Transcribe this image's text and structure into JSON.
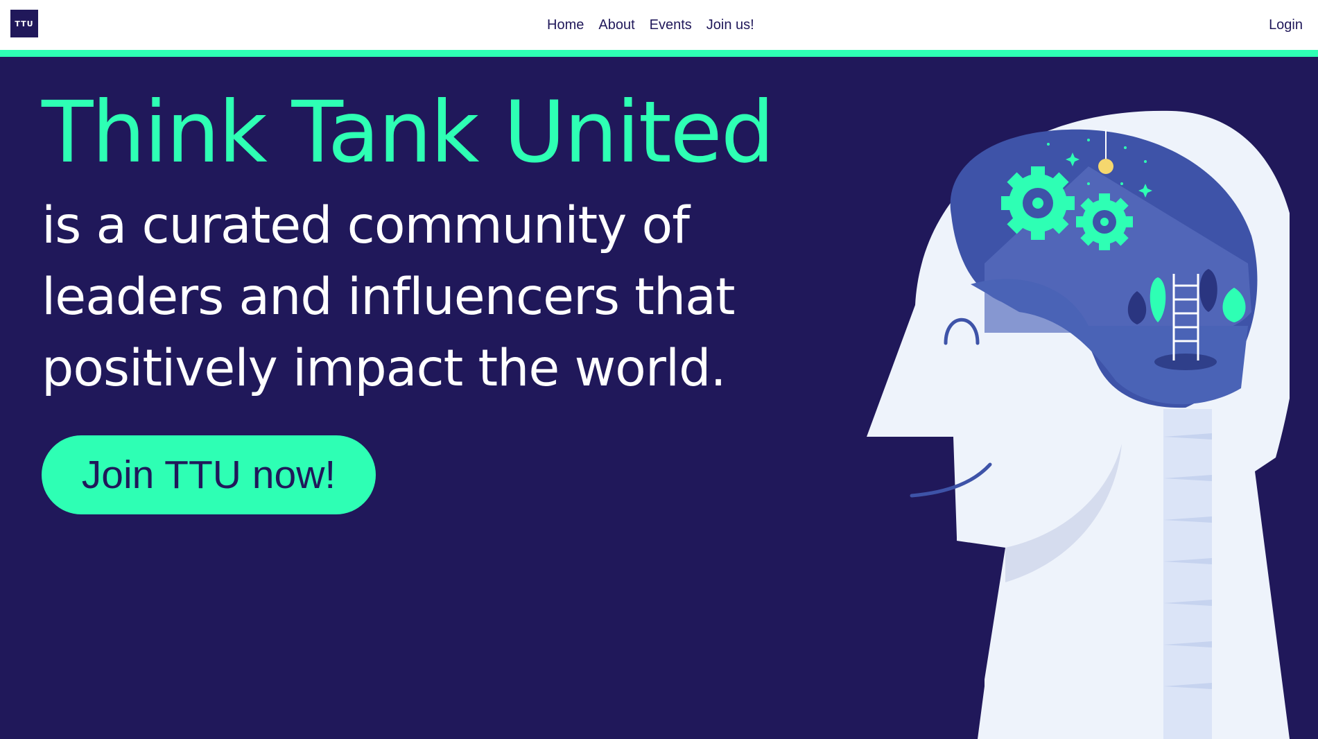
{
  "brand": {
    "logo_text": "TTU"
  },
  "nav": {
    "items": [
      "Home",
      "About",
      "Events",
      "Join us!"
    ],
    "login": "Login"
  },
  "hero": {
    "title": "Think Tank United",
    "subtitle": "is a curated community of leaders and influencers that positively impact the world.",
    "cta": "Join TTU now!"
  },
  "colors": {
    "background": "#20185a",
    "accent": "#2effb4",
    "text": "#ffffff"
  },
  "illustration": {
    "icon": "thinking-head-with-gears-icon"
  }
}
